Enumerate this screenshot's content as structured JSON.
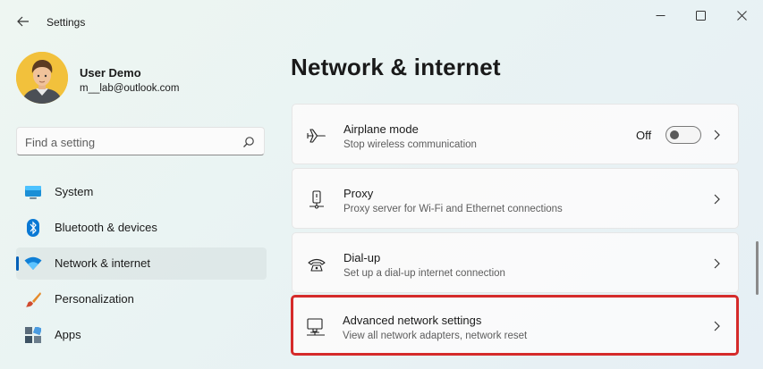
{
  "window": {
    "title": "Settings"
  },
  "profile": {
    "name": "User Demo",
    "email": "m__lab@outlook.com"
  },
  "search": {
    "placeholder": "Find a setting",
    "value": ""
  },
  "sidebar": {
    "items": [
      {
        "label": "System",
        "icon": "monitor-icon",
        "selected": false
      },
      {
        "label": "Bluetooth & devices",
        "icon": "bluetooth-icon",
        "selected": false
      },
      {
        "label": "Network & internet",
        "icon": "wifi-icon",
        "selected": true
      },
      {
        "label": "Personalization",
        "icon": "brush-icon",
        "selected": false
      },
      {
        "label": "Apps",
        "icon": "apps-icon",
        "selected": false
      }
    ]
  },
  "main": {
    "title": "Network & internet",
    "cards": [
      {
        "title": "Airplane mode",
        "description": "Stop wireless communication",
        "icon": "airplane-icon",
        "toggle": {
          "state": "Off",
          "on": false
        }
      },
      {
        "title": "Proxy",
        "description": "Proxy server for Wi-Fi and Ethernet connections",
        "icon": "proxy-icon"
      },
      {
        "title": "Dial-up",
        "description": "Set up a dial-up internet connection",
        "icon": "dialup-icon"
      },
      {
        "title": "Advanced network settings",
        "description": "View all network adapters, network reset",
        "icon": "network-pc-icon",
        "highlighted": true
      }
    ]
  },
  "colors": {
    "accent": "#005fb8",
    "highlight_border": "#d52a2a",
    "background": "#eef6f2"
  }
}
